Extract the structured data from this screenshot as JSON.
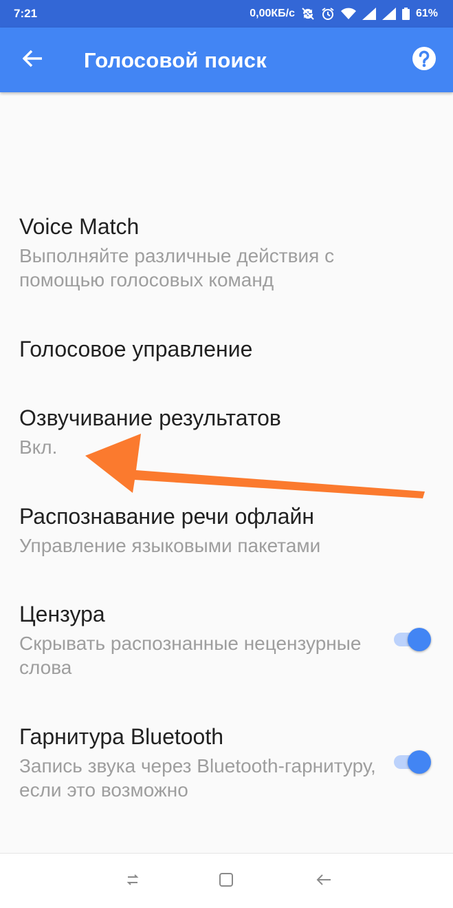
{
  "status_bar": {
    "time": "7:21",
    "network_speed": "0,00КБ/с",
    "battery_percent": "61%",
    "icons": [
      "no-sync-icon",
      "alarm-icon",
      "wifi-icon",
      "signal-icon",
      "signal-icon",
      "battery-icon"
    ]
  },
  "app_bar": {
    "title": "Голосовой поиск",
    "back_icon": "arrow-back-icon",
    "help_icon": "help-icon",
    "color": "#4285f4"
  },
  "settings": [
    {
      "title": "Voice Match",
      "subtitle": "Выполняйте различные действия с помощью голосовых команд"
    },
    {
      "title": "Голосовое управление",
      "subtitle": ""
    },
    {
      "title": "Озвучивание результатов",
      "subtitle": "Вкл."
    },
    {
      "title": "Распознавание речи офлайн",
      "subtitle": "Управление языковыми пакетами"
    },
    {
      "title": "Цензура",
      "subtitle": "Скрывать распознанные нецензурные слова",
      "toggle": true
    },
    {
      "title": "Гарнитура Bluetooth",
      "subtitle": "Запись звука через Bluetooth-гарнитуру, если это возможно",
      "toggle": true
    }
  ],
  "annotation": {
    "type": "arrow",
    "color": "#fb7a2e",
    "points_to": "Озвучивание результатов"
  },
  "nav_bar": {
    "icons": [
      "recent-apps-icon",
      "home-icon",
      "back-icon"
    ]
  }
}
